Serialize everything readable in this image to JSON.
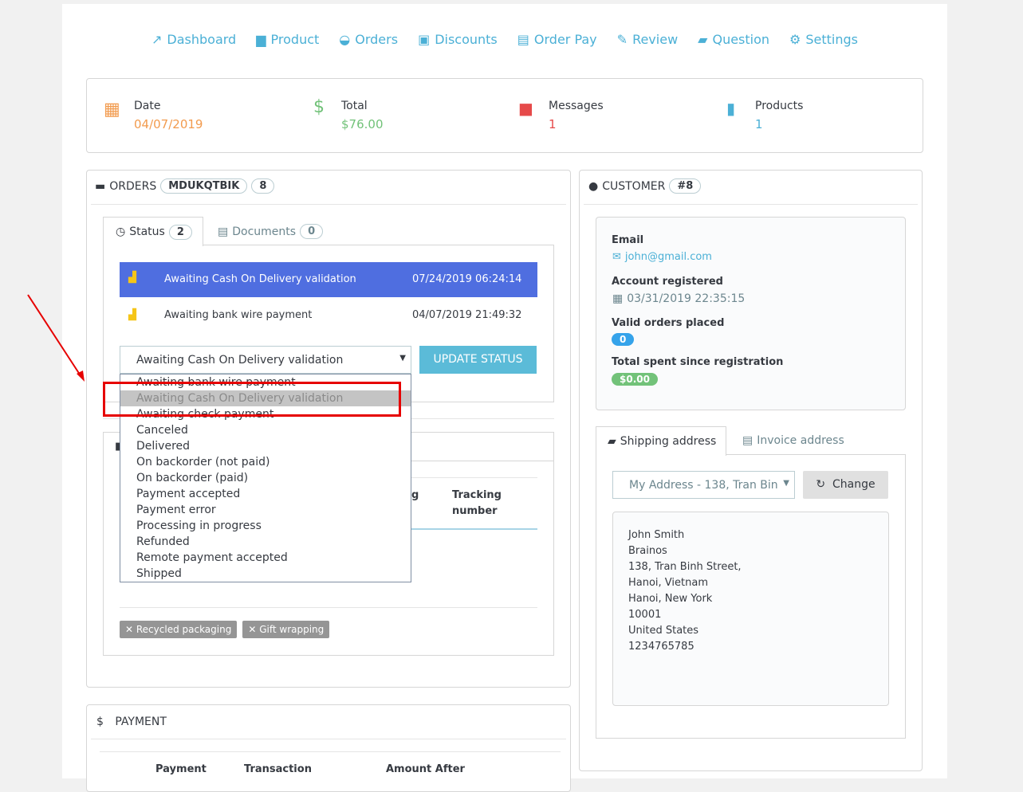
{
  "nav": [
    {
      "icon": "chart-line-icon",
      "label": "Dashboard"
    },
    {
      "icon": "store-icon",
      "label": "Product"
    },
    {
      "icon": "basket-icon",
      "label": "Orders"
    },
    {
      "icon": "gift-icon",
      "label": "Discounts"
    },
    {
      "icon": "money-icon",
      "label": "Order Pay"
    },
    {
      "icon": "review-icon",
      "label": "Review"
    },
    {
      "icon": "forum-icon",
      "label": "Question"
    },
    {
      "icon": "gear-icon",
      "label": "Settings"
    }
  ],
  "kpis": [
    {
      "label": "Date",
      "value": "04/07/2019",
      "color": "#f29b4e"
    },
    {
      "label": "Total",
      "value": "$76.00",
      "color": "#72c279"
    },
    {
      "label": "Messages",
      "value": "1",
      "color": "#e64a4a"
    },
    {
      "label": "Products",
      "value": "1",
      "color": "#4bb0d6"
    }
  ],
  "orders": {
    "title": "ORDERS",
    "reference": "MDUKQTBIK",
    "id": "8",
    "tabs": [
      {
        "label": "Status",
        "count": "2"
      },
      {
        "label": "Documents",
        "count": "0"
      }
    ],
    "history": [
      {
        "status": "Awaiting Cash On Delivery validation",
        "date": "07/24/2019 06:24:14"
      },
      {
        "status": "Awaiting bank wire payment",
        "date": "04/07/2019 21:49:32"
      }
    ],
    "select_value": "Awaiting Cash On Delivery validation",
    "update_button": "UPDATE STATUS",
    "options": [
      "Awaiting bank wire payment",
      "Awaiting Cash On Delivery validation",
      "Awaiting check payment",
      "Canceled",
      "Delivered",
      "On backorder (not paid)",
      "On backorder (paid)",
      "Payment accepted",
      "Payment error",
      "Processing in progress",
      "Refunded",
      "Remote payment accepted",
      "Shipped"
    ],
    "highlighted_option": "Awaiting Cash On Delivery validation",
    "shipping_headers": [
      "g",
      "Tracking number"
    ],
    "tags": [
      "Recycled packaging",
      "Gift wrapping"
    ]
  },
  "payment": {
    "title": "PAYMENT",
    "headers": [
      "Payment",
      "Transaction",
      "Amount After"
    ]
  },
  "customer": {
    "title": "CUSTOMER",
    "id": "#8",
    "email_label": "Email",
    "email": "john@gmail.com",
    "registered_label": "Account registered",
    "registered": "03/31/2019 22:35:15",
    "orders_label": "Valid orders placed",
    "orders": "0",
    "spent_label": "Total spent since registration",
    "spent": "$0.00",
    "tabs": [
      "Shipping address",
      "Invoice address"
    ],
    "address_select": "My Address - 138, Tran Bin",
    "change_button": "Change",
    "address": [
      "John Smith",
      "Brainos",
      "138, Tran Binh Street,",
      "Hanoi, Vietnam",
      "Hanoi, New York",
      "10001",
      "United States",
      "1234765785"
    ]
  },
  "colors": {
    "accent": "#4bb0d6",
    "active_row": "#4f6ee0",
    "annotation": "#e60000"
  }
}
